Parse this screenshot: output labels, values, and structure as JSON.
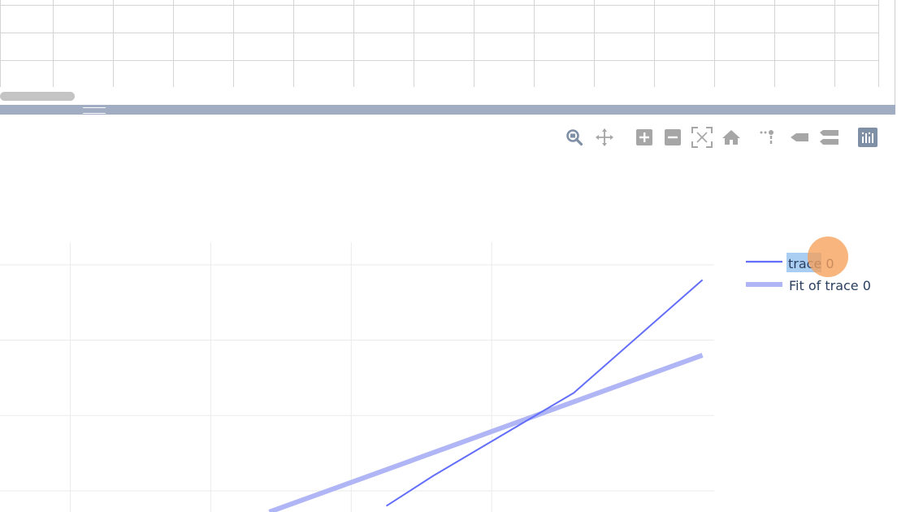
{
  "modebar": {
    "buttons": [
      {
        "name": "zoom",
        "icon": "zoom-icon",
        "active": true
      },
      {
        "name": "pan",
        "icon": "pan-icon"
      },
      {
        "name": "zoom-in",
        "icon": "zoom-in-icon"
      },
      {
        "name": "zoom-out",
        "icon": "zoom-out-icon"
      },
      {
        "name": "autoscale",
        "icon": "autoscale-icon"
      },
      {
        "name": "reset-axes",
        "icon": "home-icon"
      },
      {
        "name": "toggle-spike-lines",
        "icon": "spike-lines-icon"
      },
      {
        "name": "show-closest",
        "icon": "hover-closest-icon"
      },
      {
        "name": "compare-hover",
        "icon": "hover-compare-icon"
      },
      {
        "name": "plotly-logo",
        "icon": "plotly-logo-icon"
      }
    ]
  },
  "legend": {
    "items": [
      {
        "label": "trace 0",
        "color": "#636efa",
        "selected": true
      },
      {
        "label": "Fit of trace 0",
        "color": "#b0b5f5"
      }
    ]
  },
  "chart_data": {
    "type": "line",
    "series": [
      {
        "name": "trace 0",
        "color": "#636efa",
        "points": [
          [
            0.66,
            -0.2
          ],
          [
            0.74,
            0.2
          ],
          [
            0.98,
            1.3
          ],
          [
            1.2,
            2.8
          ]
        ]
      },
      {
        "name": "Fit of trace 0",
        "color": "#b0b5f5",
        "points": [
          [
            0.46,
            -0.28
          ],
          [
            1.2,
            1.8
          ]
        ]
      }
    ],
    "x_grid": [
      0.12,
      0.36,
      0.6,
      0.84
    ],
    "y_grid": [
      0,
      1,
      2,
      3
    ],
    "xlim": [
      0,
      1.22
    ],
    "ylim": [
      -0.28,
      3.3
    ],
    "grid": true
  },
  "colors": {
    "accent": "#636efa",
    "fit": "#b0b5f5",
    "splitter": "#a0adc2",
    "modebar_icon": "#a6a6a6",
    "modebar_active": "#7f8fa6",
    "cursor": "#f6a05a"
  }
}
